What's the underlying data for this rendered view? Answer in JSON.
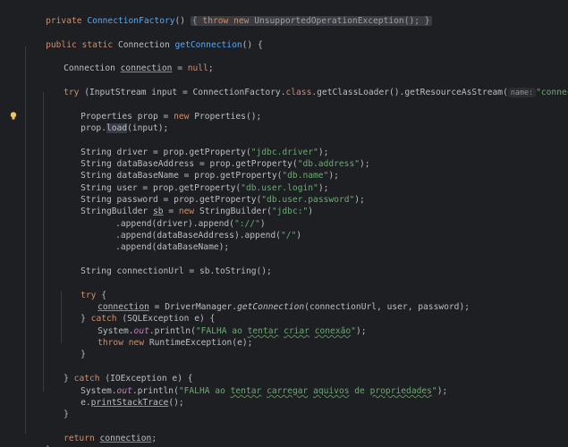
{
  "window": {
    "background": "#1e1f22",
    "keyword_color": "#cf8e6d",
    "method_color": "#56a8f5",
    "string_color": "#6aab73",
    "text_color": "#bcbec4"
  },
  "gutter": {
    "icon": "lightbulb-icon"
  },
  "code": {
    "l1": {
      "a": "private ",
      "b": "ConnectionFactory",
      "c": "() ",
      "d": "{",
      "e": " throw new ",
      "f": "UnsupportedOperationException(); ",
      "g": "}"
    },
    "l2": {
      "a": "public static ",
      "b": "Connection ",
      "c": "getConnection",
      "d": "() {"
    },
    "l3": {
      "a": "Connection ",
      "b": "connection",
      "c": " = ",
      "d": "null",
      "e": ";"
    },
    "l4": {
      "a": "try ",
      "b": "(InputStream input = ConnectionFactory.",
      "c": "class",
      "d": ".getClassLoader().getResourceAsStream(",
      "hint": "name:",
      "e": "\"connection.properties\"",
      "f": ")) {"
    },
    "l5": {
      "a": "Properties prop = ",
      "b": "new ",
      "c": "Properties();"
    },
    "l6": {
      "a": "prop.",
      "b": "load",
      "c": "(input);"
    },
    "l7": {
      "a": "String driver = prop.getProperty(",
      "b": "\"jdbc.driver\"",
      "c": ");"
    },
    "l8": {
      "a": "String dataBaseAddress = prop.getProperty(",
      "b": "\"db.address\"",
      "c": ");"
    },
    "l9": {
      "a": "String dataBaseName = prop.getProperty(",
      "b": "\"db.name\"",
      "c": ");"
    },
    "l10": {
      "a": "String user = prop.getProperty(",
      "b": "\"db.user.login\"",
      "c": ");"
    },
    "l11": {
      "a": "String password = prop.getProperty(",
      "b": "\"db.user.password\"",
      "c": ");"
    },
    "l12": {
      "a": "StringBuilder ",
      "b": "sb",
      "c": " = ",
      "d": "new ",
      "e": "StringBuilder(",
      "f": "\"jdbc:\"",
      "g": ")"
    },
    "l13": {
      "a": ".append(driver).append(",
      "b": "\"://\"",
      "c": ")"
    },
    "l14": {
      "a": ".append(dataBaseAddress).append(",
      "b": "\"/\"",
      "c": ")"
    },
    "l15": {
      "a": ".append(dataBaseName);"
    },
    "l16": {
      "a": "String connectionUrl = sb.toString();"
    },
    "l17": {
      "a": "try ",
      "b": "{"
    },
    "l18": {
      "a": "connection",
      "b": " = DriverManager.",
      "c": "getConnection",
      "d": "(connectionUrl, user, password);"
    },
    "l19": {
      "a": "} ",
      "b": "catch ",
      "c": "(SQLException e) {"
    },
    "l20": {
      "a": "System.",
      "b": "out",
      "c": ".println(",
      "d": "\"FALHA ao ",
      "e": "tentar",
      "f": " ",
      "g": "criar",
      "h": " ",
      "i": "conexão",
      "j": "\"",
      "k": ");"
    },
    "l21": {
      "a": "throw new ",
      "b": "RuntimeException(e);"
    },
    "l22": {
      "a": "}"
    },
    "l23": {
      "a": "} ",
      "b": "catch ",
      "c": "(IOException e) {"
    },
    "l24": {
      "a": "System.",
      "b": "out",
      "c": ".println(",
      "d": "\"FALHA ao ",
      "e": "tentar",
      "f": " ",
      "g": "carregar",
      "h": " ",
      "i": "aquivos",
      "j": " de ",
      "k": "propriedades",
      "l": "\"",
      "m": ");"
    },
    "l25": {
      "a": "e.",
      "b": "printStackTrace",
      "c": "();"
    },
    "l26": {
      "a": "}"
    },
    "l27": {
      "a": "return ",
      "b": "connection",
      "c": ";"
    },
    "l28": {
      "a": "}"
    }
  }
}
